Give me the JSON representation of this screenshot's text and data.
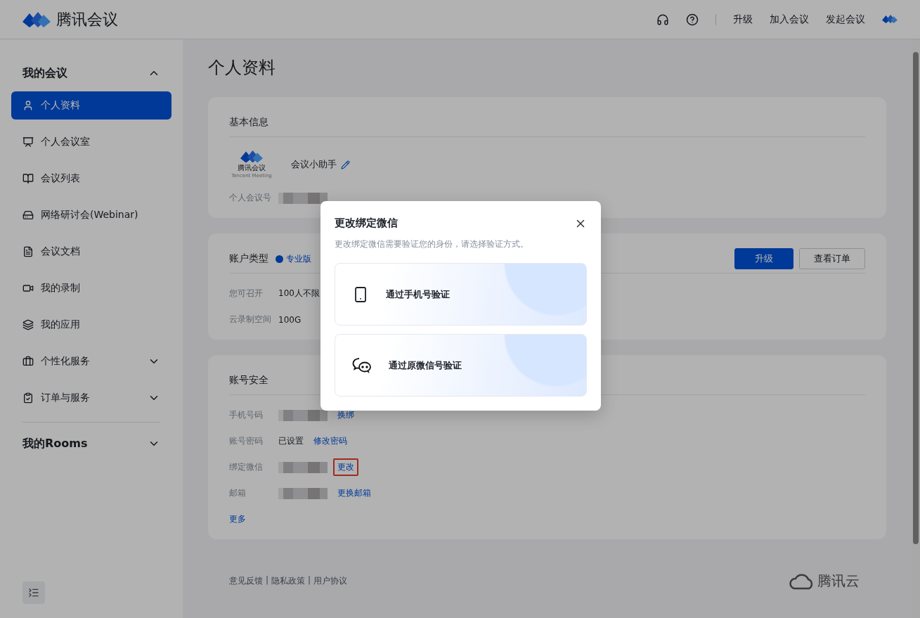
{
  "header": {
    "brand": "腾讯会议",
    "actions": [
      "升级",
      "加入会议",
      "发起会议"
    ]
  },
  "sidebar": {
    "groups": [
      {
        "label": "我的会议",
        "expanded": true,
        "items": [
          {
            "label": "个人资料",
            "selected": true
          },
          {
            "label": "个人会议室",
            "selected": false
          },
          {
            "label": "会议列表",
            "selected": false
          },
          {
            "label": "网络研讨会(Webinar)",
            "selected": false
          },
          {
            "label": "会议文档",
            "selected": false
          },
          {
            "label": "我的录制",
            "selected": false
          },
          {
            "label": "我的应用",
            "selected": false
          },
          {
            "label": "个性化服务",
            "selected": false,
            "expandable": true
          },
          {
            "label": "订单与服务",
            "selected": false,
            "expandable": true
          }
        ]
      },
      {
        "label": "我的Rooms",
        "expanded": false
      }
    ]
  },
  "page_title": "个人资料",
  "basic_info": {
    "title": "基本信息",
    "avatar_text": "腾讯会议",
    "avatar_subtext": "Tencent Meeting",
    "name": "会议小助手",
    "rows": [
      {
        "label": "个人会议号",
        "blurred": true
      }
    ]
  },
  "account_type": {
    "title": "账户类型",
    "badge": "专业版",
    "buttons": [
      {
        "label": "升级",
        "primary": true
      },
      {
        "label": "查看订单",
        "primary": false
      }
    ],
    "rows": [
      {
        "label": "您可召开",
        "value": "100人不限"
      },
      {
        "label": "云录制空间",
        "value": "100G"
      }
    ]
  },
  "security": {
    "title": "账号安全",
    "rows": [
      {
        "label": "手机号码",
        "value": "",
        "blurred": true,
        "link": "换绑",
        "highlighted": false
      },
      {
        "label": "账号密码",
        "value": "已设置",
        "blurred": false,
        "link": "修改密码",
        "highlighted": false
      },
      {
        "label": "绑定微信",
        "value": "",
        "blurred": true,
        "link": "更改",
        "highlighted": true
      },
      {
        "label": "邮箱",
        "value": "",
        "blurred": true,
        "link": "更换邮箱",
        "highlighted": false
      }
    ],
    "more": "更多"
  },
  "footer": {
    "links": [
      "意见反馈",
      "隐私政策",
      "用户协议"
    ],
    "separator": "|",
    "cloud_brand": "腾讯云"
  },
  "dialog": {
    "title": "更改绑定微信",
    "description": "更改绑定微信需要验证您的身份，请选择验证方式。",
    "options": [
      {
        "kind": "phone",
        "label": "通过手机号验证"
      },
      {
        "kind": "wechat",
        "label": "通过原微信号验证"
      }
    ]
  }
}
